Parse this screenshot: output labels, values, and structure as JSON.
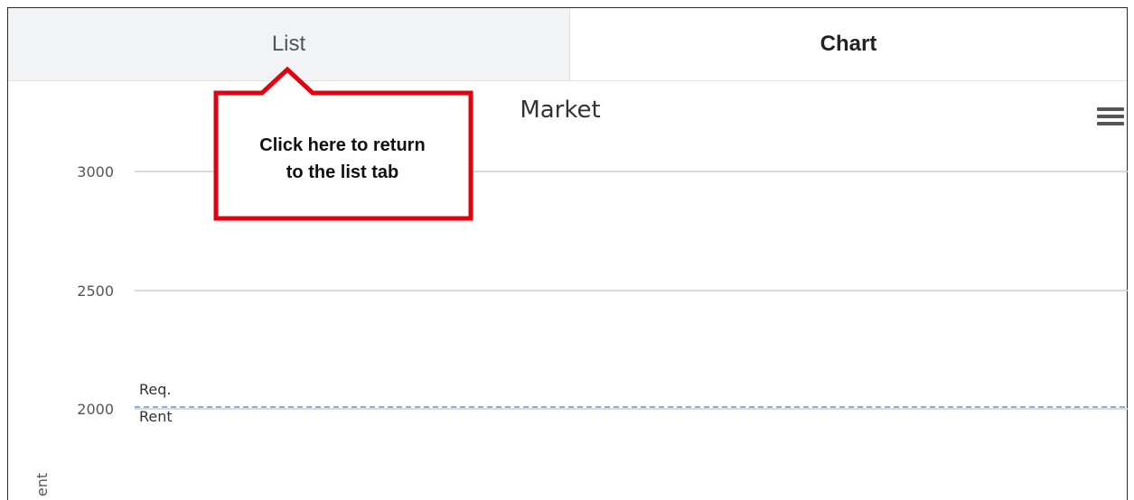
{
  "tabs": [
    {
      "label": "List",
      "active": false
    },
    {
      "label": "Chart",
      "active": true
    }
  ],
  "callout": {
    "text_line1": "Click here to return",
    "text_line2": "to the list tab",
    "border_color": "#e4000f"
  },
  "chart_data": {
    "type": "line",
    "title": "Market",
    "ylabel": "ent",
    "yticks": [
      3000,
      2500,
      2000
    ],
    "plot_lines": [
      {
        "label_line1": "Req.",
        "label_line2": "Rent",
        "value": 2000,
        "style": "dashed",
        "color": "#8ab0d8"
      }
    ],
    "series": []
  },
  "icons": {
    "menu": "hamburger-menu-icon"
  }
}
